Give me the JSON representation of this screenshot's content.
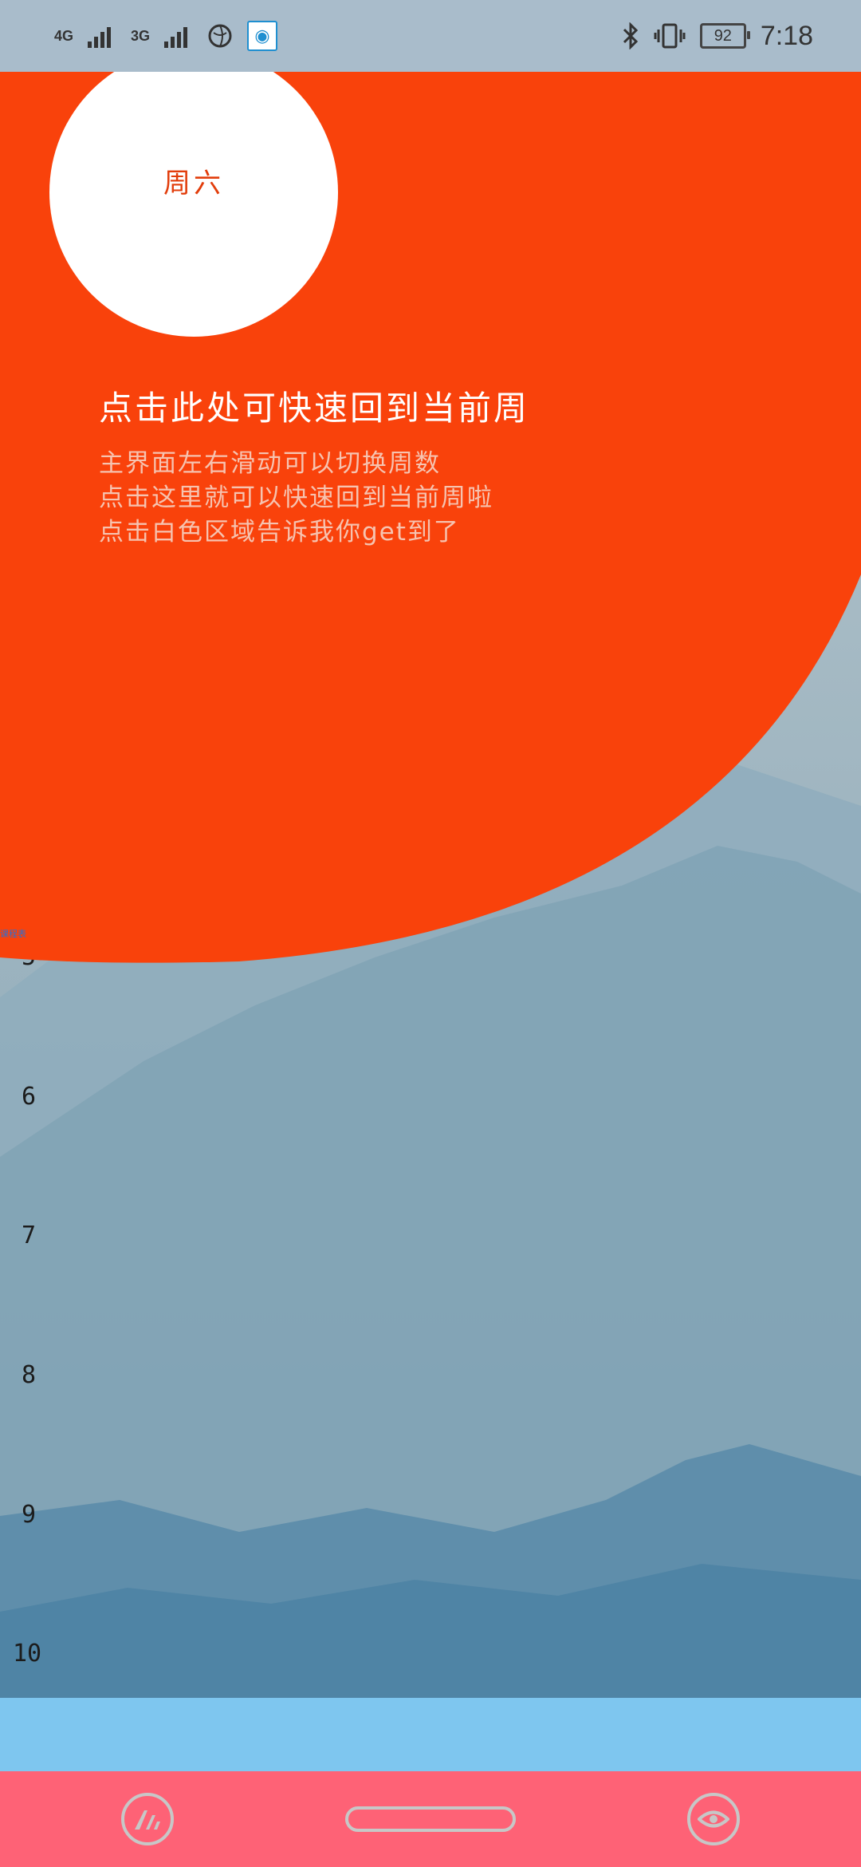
{
  "status_bar": {
    "network_1": "4G",
    "network_2": "3G",
    "battery_level": "92",
    "time": "7:18"
  },
  "guide": {
    "spotlight_label": "周六",
    "title": "点击此处可快速回到当前周",
    "lines": [
      "主界面左右滑动可以切换周数",
      "点击这里就可以快速回到当前周啦",
      "点击白色区域告诉我你get到了"
    ],
    "tiny_tag": "课程表"
  },
  "schedule": {
    "row_numbers": [
      "5",
      "6",
      "7",
      "8",
      "9",
      "10"
    ]
  },
  "colors": {
    "overlay": "#f9420b",
    "status_bar": "#a9bccb",
    "nav_bar": "#fe6276",
    "bottom_strip": "#7ec6ef"
  },
  "icons": {
    "status_left": [
      "signal-icon",
      "signal-icon",
      "vpn-globe-icon",
      "app-notification-icon"
    ],
    "status_right": [
      "bluetooth-icon",
      "vibrate-icon",
      "battery-icon"
    ],
    "nav": [
      "app-logo-icon",
      "home-pill",
      "eye-icon"
    ]
  }
}
